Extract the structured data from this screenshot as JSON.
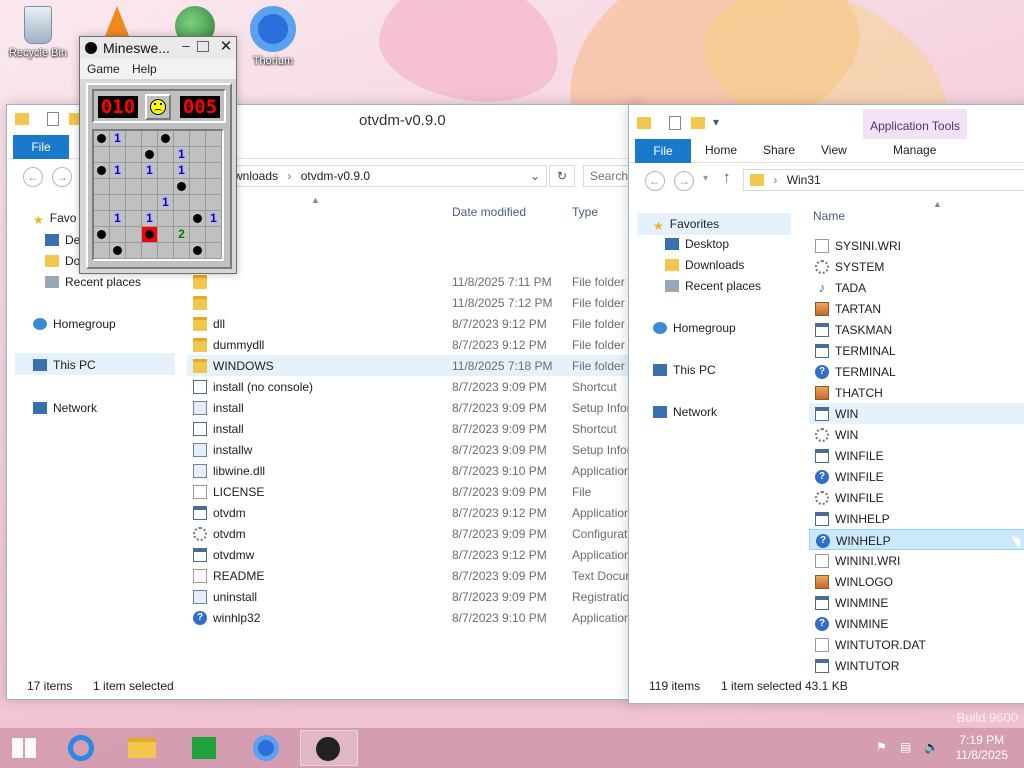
{
  "desktop": {
    "icons": [
      {
        "label": "Recycle Bin",
        "icon": "recycle-bin-icon"
      },
      {
        "label": "Thorium",
        "icon": "thorium-browser-icon"
      }
    ],
    "watermark": "Build 9600"
  },
  "minesweeper": {
    "title": "Mineswe...",
    "menu": [
      "Game",
      "Help"
    ],
    "mines_left": "010",
    "timer": "005",
    "face": "sad",
    "grid": [
      [
        "m",
        "1",
        "",
        "",
        "m",
        "",
        "",
        ""
      ],
      [
        "",
        "",
        "",
        "m",
        "",
        "1",
        "",
        ""
      ],
      [
        "m",
        "1",
        "",
        "1",
        "",
        "1",
        "",
        ""
      ],
      [
        "",
        "",
        "",
        "",
        "",
        "m",
        "",
        ""
      ],
      [
        "",
        "",
        "",
        "",
        "1",
        "",
        "",
        ""
      ],
      [
        "",
        "1",
        "",
        "1",
        "",
        "",
        "m",
        "1"
      ],
      [
        "m",
        "",
        "",
        "x",
        "",
        "2",
        "",
        ""
      ],
      [
        "",
        "m",
        "",
        "",
        "",
        "",
        "m",
        ""
      ]
    ]
  },
  "explorer_left": {
    "title": "otvdm-v0.9.0",
    "ribbon": {
      "file": "File"
    },
    "address": [
      "wnloads",
      "otvdm-v0.9.0"
    ],
    "search_placeholder": "Search",
    "nav": {
      "favorites": "Favo",
      "desktop": "De",
      "downloads": "Do",
      "recent": "Recent places",
      "homegroup": "Homegroup",
      "thispc": "This PC",
      "network": "Network"
    },
    "columns": {
      "date": "Date modified",
      "type": "Type"
    },
    "files": [
      {
        "name": "",
        "date": "11/8/2025 7:11 PM",
        "type": "File folder",
        "icon": "folder"
      },
      {
        "name": "",
        "date": "11/8/2025 7:12 PM",
        "type": "File folder",
        "icon": "folder"
      },
      {
        "name": "dll",
        "date": "8/7/2023 9:12 PM",
        "type": "File folder",
        "icon": "folder"
      },
      {
        "name": "dummydll",
        "date": "8/7/2023 9:12 PM",
        "type": "File folder",
        "icon": "folder"
      },
      {
        "name": "WINDOWS",
        "date": "11/8/2025 7:18 PM",
        "type": "File folder",
        "icon": "folder"
      },
      {
        "name": "install (no console)",
        "date": "8/7/2023 9:09 PM",
        "type": "Shortcut",
        "icon": "shortcut"
      },
      {
        "name": "install",
        "date": "8/7/2023 9:09 PM",
        "type": "Setup Infor",
        "icon": "setup"
      },
      {
        "name": "install",
        "date": "8/7/2023 9:09 PM",
        "type": "Shortcut",
        "icon": "shortcut"
      },
      {
        "name": "installw",
        "date": "8/7/2023 9:09 PM",
        "type": "Setup Infor",
        "icon": "setup"
      },
      {
        "name": "libwine.dll",
        "date": "8/7/2023 9:10 PM",
        "type": "Application",
        "icon": "setup"
      },
      {
        "name": "LICENSE",
        "date": "8/7/2023 9:09 PM",
        "type": "File",
        "icon": "doc"
      },
      {
        "name": "otvdm",
        "date": "8/7/2023 9:12 PM",
        "type": "Application",
        "icon": "app"
      },
      {
        "name": "otvdm",
        "date": "8/7/2023 9:09 PM",
        "type": "Configurat",
        "icon": "gear"
      },
      {
        "name": "otvdmw",
        "date": "8/7/2023 9:12 PM",
        "type": "Application",
        "icon": "app"
      },
      {
        "name": "README",
        "date": "8/7/2023 9:09 PM",
        "type": "Text Docur",
        "icon": "doc"
      },
      {
        "name": "uninstall",
        "date": "8/7/2023 9:09 PM",
        "type": "Registration",
        "icon": "setup"
      },
      {
        "name": "winhlp32",
        "date": "8/7/2023 9:10 PM",
        "type": "Application",
        "icon": "help"
      }
    ],
    "status": {
      "count": "17 items",
      "selected": "1 item selected"
    }
  },
  "explorer_right": {
    "context_tab": "Application Tools",
    "ribbon": {
      "file": "File",
      "home": "Home",
      "share": "Share",
      "view": "View",
      "manage": "Manage"
    },
    "address": "Win31",
    "nav": {
      "favorites": "Favorites",
      "desktop": "Desktop",
      "downloads": "Downloads",
      "recent": "Recent places",
      "homegroup": "Homegroup",
      "thispc": "This PC",
      "network": "Network"
    },
    "columns": {
      "name": "Name"
    },
    "files": [
      {
        "name": "SYSINI.WRI",
        "icon": "doc"
      },
      {
        "name": "SYSTEM",
        "icon": "gear"
      },
      {
        "name": "TADA",
        "icon": "note"
      },
      {
        "name": "TARTAN",
        "icon": "img"
      },
      {
        "name": "TASKMAN",
        "icon": "app"
      },
      {
        "name": "TERMINAL",
        "icon": "app"
      },
      {
        "name": "TERMINAL",
        "icon": "help"
      },
      {
        "name": "THATCH",
        "icon": "img"
      },
      {
        "name": "WIN",
        "icon": "app"
      },
      {
        "name": "WIN",
        "icon": "gear"
      },
      {
        "name": "WINFILE",
        "icon": "app"
      },
      {
        "name": "WINFILE",
        "icon": "help"
      },
      {
        "name": "WINFILE",
        "icon": "gear"
      },
      {
        "name": "WINHELP",
        "icon": "app"
      },
      {
        "name": "WINHELP",
        "icon": "help"
      },
      {
        "name": "WININI.WRI",
        "icon": "doc"
      },
      {
        "name": "WINLOGO",
        "icon": "img"
      },
      {
        "name": "WINMINE",
        "icon": "app"
      },
      {
        "name": "WINMINE",
        "icon": "help"
      },
      {
        "name": "WINTUTOR.DAT",
        "icon": "doc"
      },
      {
        "name": "WINTUTOR",
        "icon": "app"
      }
    ],
    "status": {
      "count": "119 items",
      "selected": "1 item selected",
      "size": "43.1 KB"
    }
  },
  "taskbar": {
    "time": "7:19 PM",
    "date": "11/8/2025",
    "apps": [
      "start-icon",
      "internet-explorer-icon",
      "file-explorer-icon",
      "store-icon",
      "thorium-icon",
      "minesweeper-icon"
    ]
  }
}
